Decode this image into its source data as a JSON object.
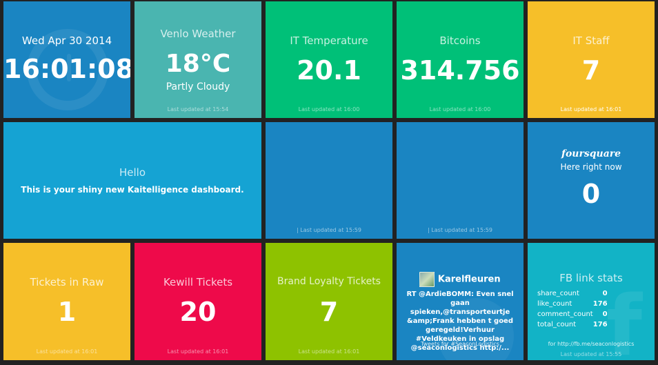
{
  "clock": {
    "date": "Wed Apr 30 2014",
    "time": "16:01:08"
  },
  "weather": {
    "title": "Venlo Weather",
    "temp": "18°C",
    "condition": "Partly Cloudy",
    "updated": "Last updated at 15:54"
  },
  "it_temp": {
    "title": "IT Temperature",
    "value": "20.1",
    "updated": "Last updated at 16:00"
  },
  "bitcoins": {
    "title": "Bitcoins",
    "value": "314.756",
    "updated": "Last updated at 16:00"
  },
  "it_staff": {
    "title": "IT Staff",
    "value": "7",
    "updated": "Last updated at 16:01"
  },
  "hello": {
    "title": "Hello",
    "text": "This is your shiny new Kaitelligence dashboard."
  },
  "blank1": {
    "updated": "| Last updated at 15:59"
  },
  "blank2": {
    "updated": "| Last updated at 15:59"
  },
  "foursquare": {
    "logo": "foursquare",
    "subtitle": "Here right now",
    "value": "0"
  },
  "tickets_raw": {
    "title": "Tickets in Raw",
    "value": "1",
    "updated": "Last updated at 16:01"
  },
  "kewill": {
    "title": "Kewill Tickets",
    "value": "20",
    "updated": "Last updated at 16:01"
  },
  "brand": {
    "title": "Brand Loyalty Tickets",
    "value": "7",
    "updated": "Last updated at 16:01"
  },
  "twitter": {
    "user": "Karelfleuren",
    "tweet": "RT @ArdieBOMM: Even snel gaan spieken,@transporteurtje &amp;Frank hebben t goed geregeld!Verhuur #Veldkeuken in opslag @seaconlogistics http:/...",
    "footer": "Tweets for #SeaconLogistics"
  },
  "fb": {
    "title": "FB link stats",
    "rows": [
      {
        "label": "share_count",
        "value": "0"
      },
      {
        "label": "like_count",
        "value": "176"
      },
      {
        "label": "comment_count",
        "value": "0"
      },
      {
        "label": "total_count",
        "value": "176"
      }
    ],
    "footer": "for http://fb.me/seaconlogistics",
    "updated": "Last updated at 15:55"
  },
  "colors": {
    "blue": "#1a85c2",
    "teal": "#4ab5b0",
    "green": "#00c078",
    "yellow": "#f6bf29",
    "cyan": "#15a3d3",
    "red": "#ee0a4a",
    "lime": "#8ec200",
    "aqua": "#12b3c6"
  }
}
